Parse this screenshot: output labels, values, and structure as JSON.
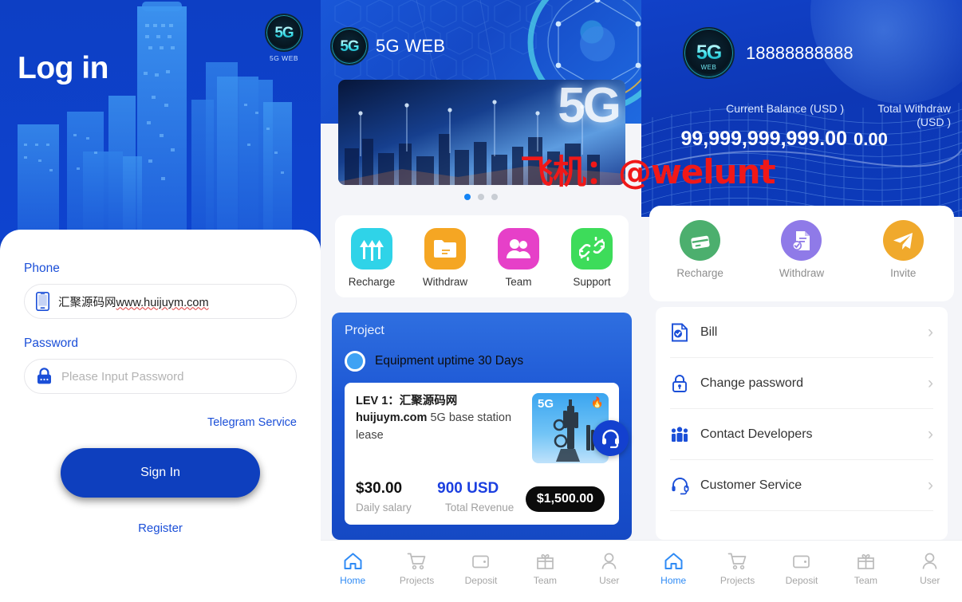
{
  "brand": {
    "badge_text": "5G",
    "badge_sub": "WEB",
    "caption": "5G WEB",
    "app_name": "5G WEB"
  },
  "login": {
    "title": "Log in",
    "phone_label": "Phone",
    "phone_value_cjk": "汇聚源码网",
    "phone_value_url": "www.huijuym.com",
    "phone_icon": "mobile-phone-icon",
    "password_label": "Password",
    "password_placeholder": "Please Input Password",
    "password_icon": "lock-icon",
    "telegram_link": "Telegram Service",
    "signin_label": "Sign In",
    "register_link": "Register"
  },
  "home": {
    "brand_text": "5G WEB",
    "banner_text": "5G",
    "carousel": {
      "count": 3,
      "active_index": 0
    },
    "quick_actions": [
      {
        "label": "Recharge",
        "icon": "up-arrows-icon",
        "color": "#2fd3e8"
      },
      {
        "label": "Withdraw",
        "icon": "folder-icon",
        "color": "#f5a623"
      },
      {
        "label": "Team",
        "icon": "people-icon",
        "color": "#e640c8"
      },
      {
        "label": "Support",
        "icon": "link-chain-icon",
        "color": "#3ddc5a"
      }
    ],
    "project": {
      "section_title": "Project",
      "uptime_label": "Equipment uptime 30 Days",
      "item_title_prefix": "LEV 1：",
      "item_title_cjk": "汇聚源码网",
      "item_title_domain": "huijuym.com",
      "item_title_rest": "5G base station lease",
      "thumb_label": "5G",
      "thumb_badge": "🔥",
      "daily_value": "$30.00",
      "daily_label": "Daily salary",
      "revenue_value": "900 USD",
      "revenue_label": "Total Revenue",
      "price": "$1,500.00",
      "support_icon": "headset-icon"
    }
  },
  "profile": {
    "phone": "18888888888",
    "balance_label": "Current Balance (USD )",
    "balance_value": "99,999,999,999.00",
    "withdraw_label": "Total Withdraw (USD )",
    "withdraw_label_l1": "Total Withdraw",
    "withdraw_label_l2": "(USD )",
    "withdraw_value": "0.00",
    "actions": [
      {
        "label": "Recharge",
        "icon": "credit-card-icon",
        "color": "#4caf6e"
      },
      {
        "label": "Withdraw",
        "icon": "document-check-icon",
        "color": "#8f7ae8"
      },
      {
        "label": "Invite",
        "icon": "paper-plane-icon",
        "color": "#f0a92c"
      }
    ],
    "menu": [
      {
        "label": "Bill",
        "icon": "bill-document-icon"
      },
      {
        "label": "Change password",
        "icon": "lock-icon"
      },
      {
        "label": "Contact Developers",
        "icon": "group-people-icon"
      },
      {
        "label": "Customer Service",
        "icon": "headset-icon"
      },
      {
        "label": "",
        "icon": "partial-icon"
      }
    ]
  },
  "bottom_nav": {
    "items": [
      {
        "label": "Home",
        "icon": "home-icon",
        "active": true
      },
      {
        "label": "Projects",
        "icon": "cart-icon",
        "active": false
      },
      {
        "label": "Deposit",
        "icon": "wallet-icon",
        "active": false
      },
      {
        "label": "Team",
        "icon": "gift-icon",
        "active": false
      },
      {
        "label": "User",
        "icon": "user-icon",
        "active": false
      }
    ]
  },
  "watermark": {
    "text": "飞机：@welunt",
    "color": "#f01818"
  },
  "colors": {
    "primary_blue": "#0d3fc4",
    "accent_blue": "#1b4fd8",
    "nav_active": "#2f8bf5"
  }
}
